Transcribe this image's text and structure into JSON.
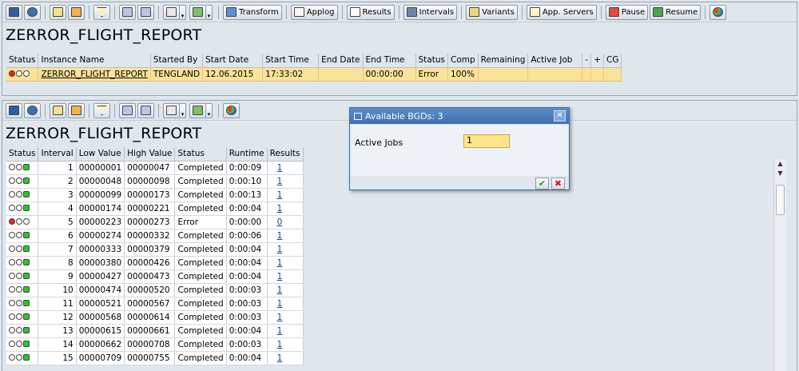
{
  "colors": {
    "background": "#dfe6ec",
    "row_highlight": "#fbe29a",
    "dialog_title": "#3e6fae",
    "input_bg": "#fde58a",
    "status_red": "#e22222",
    "status_green": "#22cc22"
  },
  "top_panel": {
    "toolbar": {
      "buttons": {
        "transform": "Transform",
        "applog": "Applog",
        "results": "Results",
        "intervals": "Intervals",
        "variants": "Variants",
        "app_servers": "App. Servers",
        "pause": "Pause",
        "resume": "Resume"
      }
    },
    "title": "ZERROR_FLIGHT_REPORT",
    "table": {
      "headers": {
        "status": "Status",
        "instance_name": "Instance Name",
        "started_by": "Started By",
        "start_date": "Start Date",
        "start_time": "Start Time",
        "end_date": "End Date",
        "end_time": "End Time",
        "status2": "Status",
        "comp": "Comp",
        "remaining": "Remaining",
        "active_job": "Active Job",
        "minus": "-",
        "plus": "+",
        "cg": "CG"
      },
      "row": {
        "status_icon": "red-light",
        "instance_name": "ZERROR_FLIGHT_REPORT",
        "started_by": "TENGLAND",
        "start_date": "12.06.2015",
        "start_time": "17:33:02",
        "end_date": "",
        "end_time": "00:00:00",
        "status": "Error",
        "comp": "100%",
        "remaining": "",
        "active_job": ""
      }
    }
  },
  "bottom_panel": {
    "title": "ZERROR_FLIGHT_REPORT",
    "table": {
      "headers": {
        "status": "Status",
        "interval": "Interval",
        "low_value": "Low Value",
        "high_value": "High Value",
        "status2": "Status",
        "runtime": "Runtime",
        "results": "Results"
      },
      "rows": [
        {
          "light": "green",
          "interval": "1",
          "low": "00000001",
          "high": "00000047",
          "status": "Completed",
          "runtime": "0:00:09",
          "results": "1"
        },
        {
          "light": "green",
          "interval": "2",
          "low": "00000048",
          "high": "00000098",
          "status": "Completed",
          "runtime": "0:00:10",
          "results": "1"
        },
        {
          "light": "green",
          "interval": "3",
          "low": "00000099",
          "high": "00000173",
          "status": "Completed",
          "runtime": "0:00:13",
          "results": "1"
        },
        {
          "light": "green",
          "interval": "4",
          "low": "00000174",
          "high": "00000221",
          "status": "Completed",
          "runtime": "0:00:04",
          "results": "1"
        },
        {
          "light": "red",
          "interval": "5",
          "low": "00000223",
          "high": "00000273",
          "status": "Error",
          "runtime": "0:00:00",
          "results": "0"
        },
        {
          "light": "green",
          "interval": "6",
          "low": "00000274",
          "high": "00000332",
          "status": "Completed",
          "runtime": "0:00:06",
          "results": "1"
        },
        {
          "light": "green",
          "interval": "7",
          "low": "00000333",
          "high": "00000379",
          "status": "Completed",
          "runtime": "0:00:04",
          "results": "1"
        },
        {
          "light": "green",
          "interval": "8",
          "low": "00000380",
          "high": "00000426",
          "status": "Completed",
          "runtime": "0:00:04",
          "results": "1"
        },
        {
          "light": "green",
          "interval": "9",
          "low": "00000427",
          "high": "00000473",
          "status": "Completed",
          "runtime": "0:00:04",
          "results": "1"
        },
        {
          "light": "green",
          "interval": "10",
          "low": "00000474",
          "high": "00000520",
          "status": "Completed",
          "runtime": "0:00:03",
          "results": "1"
        },
        {
          "light": "green",
          "interval": "11",
          "low": "00000521",
          "high": "00000567",
          "status": "Completed",
          "runtime": "0:00:03",
          "results": "1"
        },
        {
          "light": "green",
          "interval": "12",
          "low": "00000568",
          "high": "00000614",
          "status": "Completed",
          "runtime": "0:00:03",
          "results": "1"
        },
        {
          "light": "green",
          "interval": "13",
          "low": "00000615",
          "high": "00000661",
          "status": "Completed",
          "runtime": "0:00:04",
          "results": "1"
        },
        {
          "light": "green",
          "interval": "14",
          "low": "00000662",
          "high": "00000708",
          "status": "Completed",
          "runtime": "0:00:03",
          "results": "1"
        },
        {
          "light": "green",
          "interval": "15",
          "low": "00000709",
          "high": "00000755",
          "status": "Completed",
          "runtime": "0:00:04",
          "results": "1"
        }
      ]
    }
  },
  "dialog": {
    "title": "Available BGDs: 3",
    "field_label": "Active Jobs",
    "field_value": "1",
    "confirm_icon": "check-icon",
    "cancel_icon": "cancel-icon"
  }
}
